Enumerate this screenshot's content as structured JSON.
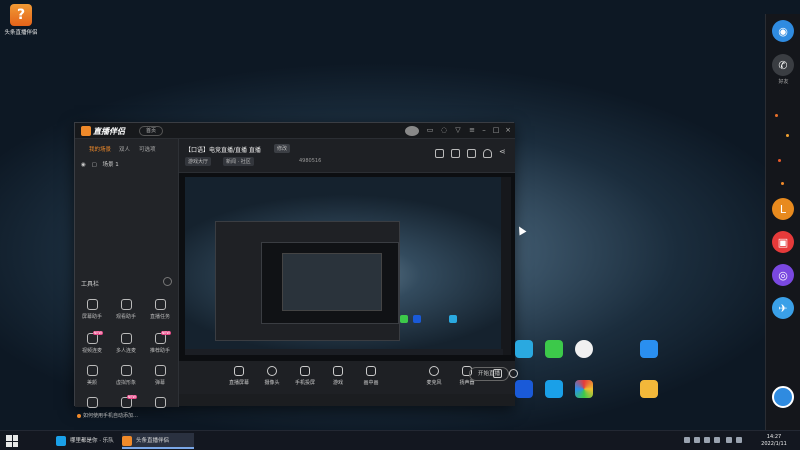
{
  "desktop": {
    "top_icon_label": "头条直播伴侣",
    "apps": [
      {
        "label": "",
        "color": "#2aa9e0"
      },
      {
        "label": "",
        "color": "#3cc94a"
      },
      {
        "label": "",
        "color": "#f0f0f0"
      },
      {
        "label": "",
        "color": "#2a8ff0"
      },
      {
        "label": "",
        "color": "#1a5ad8"
      },
      {
        "label": "",
        "color": "#1aa0e8"
      },
      {
        "label": "",
        "color": "#ffffff"
      },
      {
        "label": "",
        "color": "#f3b83a"
      }
    ]
  },
  "right_bar": {
    "items": [
      {
        "label": "",
        "color": "#2f8be0"
      },
      {
        "label": "好友",
        "color": "#3a3d42"
      },
      {
        "label": "",
        "color": "#e88a1e"
      },
      {
        "label": "",
        "color": "#e63a3a"
      },
      {
        "label": "",
        "color": "#7a48e0"
      },
      {
        "label": "",
        "color": "#3aa0e8"
      }
    ],
    "bottom_label": ""
  },
  "window": {
    "logo": "直播伴侣",
    "home_pill": "首页",
    "left_tabs": [
      "我的场景",
      "双人",
      "可选项"
    ],
    "scene": "场景 1",
    "tools_header": "工具栏",
    "tools": [
      {
        "label": "屏幕助手"
      },
      {
        "label": "观看助手"
      },
      {
        "label": "直播任务"
      },
      {
        "label": "视频连麦",
        "badge": "NEW"
      },
      {
        "label": "多人连麦"
      },
      {
        "label": "推荐助手",
        "badge": "NEW"
      },
      {
        "label": "美颜"
      },
      {
        "label": "虚拟形象"
      },
      {
        "label": "弹幕"
      },
      {
        "label": ""
      },
      {
        "label": "",
        "badge": "NEW"
      },
      {
        "label": ""
      }
    ],
    "tip": "如何使用手机自动添加…",
    "room_title": "【口语】电竞直播/直播 直播",
    "modify_label": "修改",
    "tags": [
      "游戏大厅",
      "新闻 · 社区"
    ],
    "stat": "4980516",
    "bottom_tools": [
      {
        "label": "直播屏幕"
      },
      {
        "label": "摄像头"
      },
      {
        "label": "手机投屏"
      },
      {
        "label": "游戏"
      },
      {
        "label": "画中画"
      },
      {
        "label": "麦克风"
      },
      {
        "label": "扬声器"
      }
    ],
    "live_button": "开始直播",
    "status_text": ""
  },
  "taskbar": {
    "items": [
      {
        "label": "哪里都是你 · 乐队",
        "color": "#1aa0e8"
      },
      {
        "label": "头条直播伴侣",
        "color": "#f08a2a"
      }
    ],
    "time": "14:27",
    "date": "2022/1/11"
  }
}
